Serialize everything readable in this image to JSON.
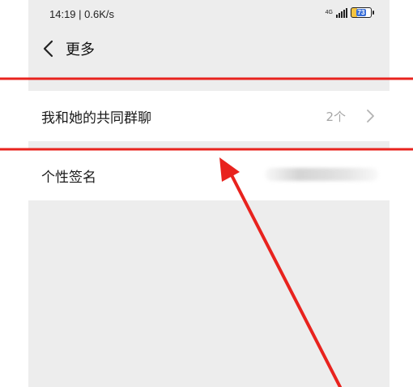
{
  "status_bar": {
    "time_speed": "14:19 | 0.6K/s",
    "network": "4G",
    "battery_level": "73"
  },
  "nav": {
    "title": "更多"
  },
  "rows": [
    {
      "label": "我和她的共同群聊",
      "value": "2个"
    },
    {
      "label": "个性签名"
    }
  ],
  "annotation_color": "#e8231e"
}
